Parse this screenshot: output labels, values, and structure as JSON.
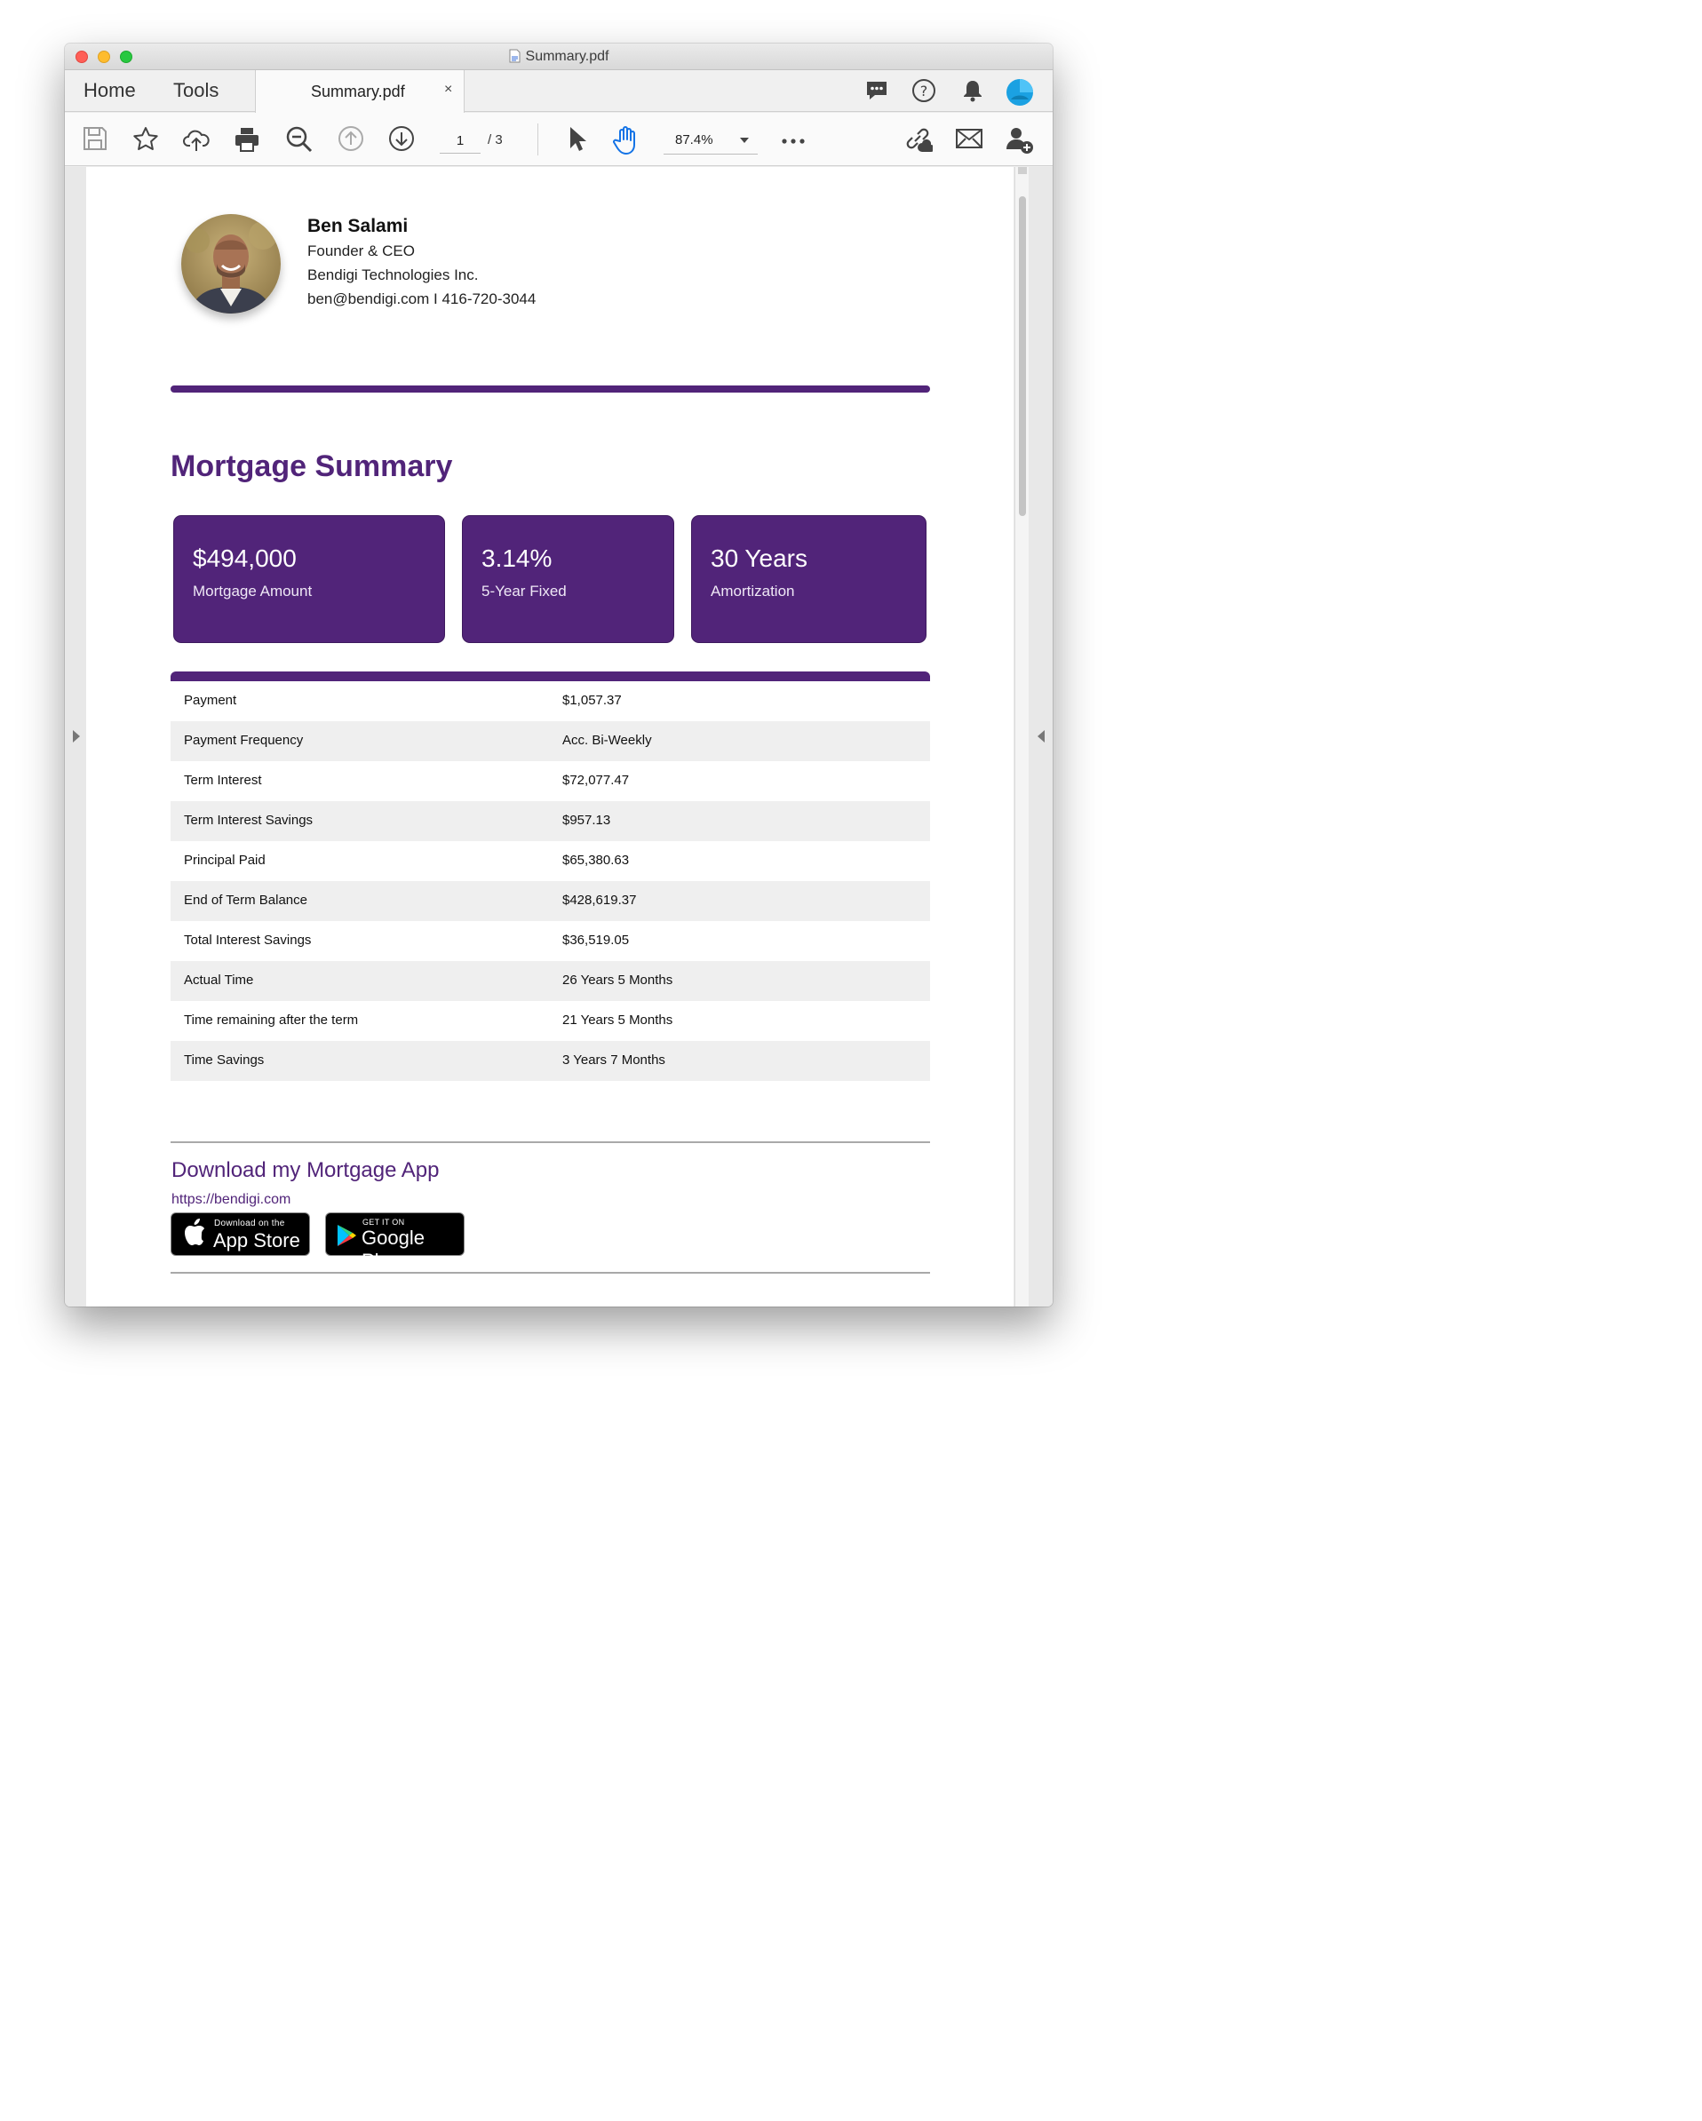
{
  "window": {
    "title": "Summary.pdf"
  },
  "tabs": {
    "home": "Home",
    "tools": "Tools",
    "document": "Summary.pdf",
    "close_glyph": "×"
  },
  "toolbar": {
    "page_current": "1",
    "page_total": "/ 3",
    "zoom": "87.4%"
  },
  "icons": [
    "document-icon",
    "comment-icon",
    "help-icon",
    "bell-icon",
    "profile-icon",
    "save-icon",
    "bookmark-star-icon",
    "upload-cloud-icon",
    "print-icon",
    "zoom-out-icon",
    "previous-page-icon",
    "next-page-icon",
    "select-cursor-icon",
    "hand-tool-icon",
    "more-icon",
    "share-link-icon",
    "email-icon",
    "add-user-icon",
    "apple-icon",
    "google-play-icon"
  ],
  "colors": {
    "brand_purple": "#512479",
    "hand_tool_active": "#1473e6",
    "profile_blue": "#1ba1e2"
  },
  "contact": {
    "name": "Ben Salami",
    "role": "Founder & CEO",
    "company": "Bendigi Technologies Inc.",
    "contact_line": "ben@bendigi.com I 416-720-3044"
  },
  "summary": {
    "title": "Mortgage Summary",
    "cards": [
      {
        "value": "$494,000",
        "label": "Mortgage Amount"
      },
      {
        "value": "3.14%",
        "label": "5-Year Fixed"
      },
      {
        "value": "30 Years",
        "label": "Amortization"
      }
    ],
    "rows": [
      {
        "label": "Payment",
        "value": "$1,057.37"
      },
      {
        "label": "Payment Frequency",
        "value": "Acc. Bi-Weekly"
      },
      {
        "label": "Term Interest",
        "value": "$72,077.47"
      },
      {
        "label": "Term Interest Savings",
        "value": "$957.13"
      },
      {
        "label": "Principal Paid",
        "value": "$65,380.63"
      },
      {
        "label": "End of Term Balance",
        "value": "$428,619.37"
      },
      {
        "label": "Total Interest Savings",
        "value": "$36,519.05"
      },
      {
        "label": "Actual Time",
        "value": "26 Years 5 Months"
      },
      {
        "label": "Time remaining after the term",
        "value": "21 Years 5 Months"
      },
      {
        "label": "Time Savings",
        "value": "3 Years 7 Months"
      }
    ]
  },
  "app": {
    "title": "Download my Mortgage App",
    "link": "https://bendigi.com",
    "appstore_small": "Download on the",
    "appstore_big": "App Store",
    "googleplay_small": "GET IT ON",
    "googleplay_big": "Google Play"
  }
}
